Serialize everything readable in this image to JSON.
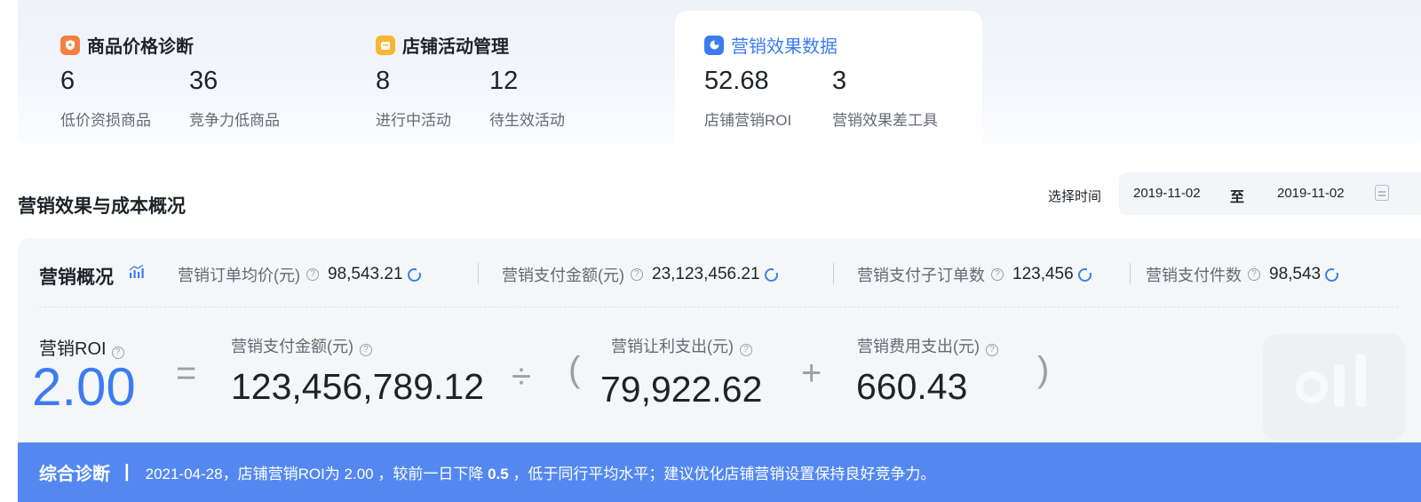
{
  "cards": [
    {
      "title": "商品价格诊断",
      "icon": "shield-icon",
      "icon_color": "#f5803e",
      "active": false,
      "stats": [
        {
          "value": "6",
          "label": "低价资损商品"
        },
        {
          "value": "36",
          "label": "竞争力低商品"
        }
      ]
    },
    {
      "title": "店铺活动管理",
      "icon": "calendar-icon",
      "icon_color": "#f7b733",
      "active": false,
      "stats": [
        {
          "value": "8",
          "label": "进行中活动"
        },
        {
          "value": "12",
          "label": "待生效活动"
        }
      ]
    },
    {
      "title": "营销效果数据",
      "icon": "pie-chart-icon",
      "icon_color": "#3d7cf0",
      "active": true,
      "stats": [
        {
          "value": "52.68",
          "label": "店铺营销ROI"
        },
        {
          "value": "3",
          "label": "营销效果差工具"
        }
      ]
    }
  ],
  "section": {
    "title": "营销效果与成本概况",
    "time_label": "选择时间",
    "date_start": "2019-11-02",
    "date_separator": "至",
    "date_end": "2019-11-02"
  },
  "overview": {
    "title": "营销概况",
    "metrics": [
      {
        "label": "营销订单均价(元)",
        "value": "98,543.21"
      },
      {
        "label": "营销支付金额(元)",
        "value": "23,123,456.21"
      },
      {
        "label": "营销支付子订单数",
        "value": "123,456"
      },
      {
        "label": "营销支付件数",
        "value": "98,543"
      }
    ]
  },
  "formula": {
    "roi_label": "营销ROI",
    "roi_value": "2.00",
    "equals": "=",
    "divide": "÷",
    "open_paren": "(",
    "plus": "+",
    "close_paren": ")",
    "pay_label": "营销支付金额(元)",
    "pay_value": "123,456,789.12",
    "discount_label": "营销让利支出(元)",
    "discount_value": "79,922.62",
    "fee_label": "营销费用支出(元)",
    "fee_value": "660.43"
  },
  "diagnosis": {
    "title": "综合诊断",
    "separator": "|",
    "text_before": "2021-04-28，店铺营销ROI为 2.00 ，较前一日下降 ",
    "highlight": "0.5",
    "text_after": " ，低于同行平均水平；建议优化店铺营销设置保持良好竞争力。"
  },
  "colors": {
    "accent": "#3d7cf0",
    "diagnosis_bar": "#5488f0"
  }
}
